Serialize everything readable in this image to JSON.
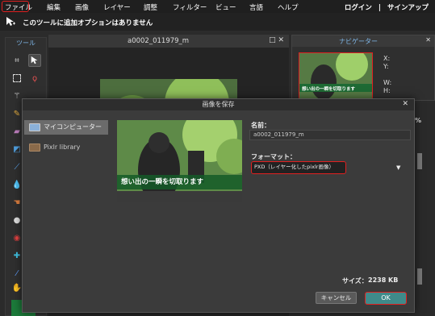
{
  "menubar": {
    "items": [
      "ファイル",
      "編集",
      "画像",
      "レイヤー",
      "調整",
      "フィルター",
      "ビュー",
      "言語",
      "ヘルプ"
    ],
    "login": "ログイン",
    "separator": "|",
    "signup": "サインアップ"
  },
  "options_bar": {
    "text": "このツールに追加オプションはありません"
  },
  "tools_panel": {
    "title": "ツール"
  },
  "document": {
    "title": "a0002_011979_m",
    "icons": "□ ✕"
  },
  "navigator": {
    "title": "ナビゲーター",
    "labels": [
      "X:",
      "Y:",
      "W:",
      "H:"
    ],
    "zoom_suffix": "%"
  },
  "dialog": {
    "title": "画像を保存",
    "close": "✕",
    "destinations": [
      "マイコンピューター",
      "Pixlr library"
    ],
    "preview_banner": "想い出の一瞬を切取ります",
    "name_label": "名前：",
    "name_value": "a0002_011979_m",
    "format_label": "フォーマット：",
    "format_value": "PXD（レイヤー化したpixlr画像）",
    "format_arrow": "▼",
    "size_label": "サイズ：",
    "size_value": "2238 KB",
    "cancel": "キャンセル",
    "ok": "OK"
  },
  "colors": {
    "accent_red": "#e02020",
    "nav_blue": "#7fb7e8",
    "ok_teal": "#3f8a8a"
  }
}
